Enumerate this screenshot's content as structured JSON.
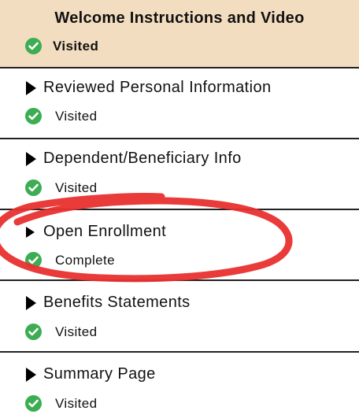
{
  "header": {
    "title": "Welcome Instructions and Video",
    "status": "Visited"
  },
  "items": [
    {
      "title": "Reviewed Personal Information",
      "status": "Visited"
    },
    {
      "title": "Dependent/Beneficiary Info",
      "status": "Visited"
    },
    {
      "title": "Open Enrollment",
      "status": "Complete"
    },
    {
      "title": "Benefits Statements",
      "status": "Visited"
    },
    {
      "title": "Summary Page",
      "status": "Visited"
    }
  ],
  "colors": {
    "header_bg": "#f3ddc0",
    "check_green": "#3cad52",
    "annotation_red": "#e8302e",
    "divider": "#222222"
  },
  "icons": {
    "status": "checkmark-circle-icon",
    "expand": "triangle-right-icon",
    "annotation": "red-circle-highlight"
  }
}
